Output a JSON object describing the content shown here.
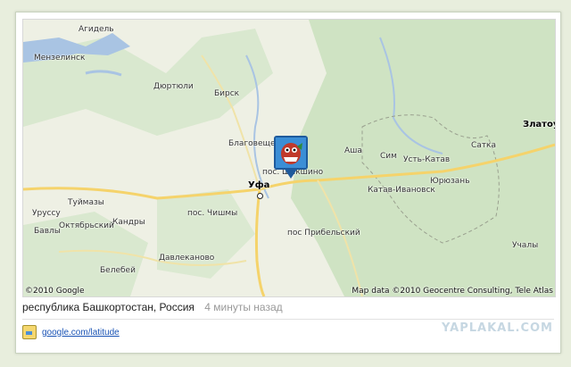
{
  "map": {
    "labels": {
      "agidel": "Агидель",
      "menzelinsk": "Мензелинск",
      "dyurtyuli": "Дюртюли",
      "birsk": "Бирск",
      "blagoveshchensk": "Благовещенск",
      "pos_chishmy": "пос. Чишмы",
      "ufa": "Уфа",
      "pos_shakshi": "пос. Шакшино",
      "pos_pribelsky": "пос Прибельский",
      "tuimazy": "Туймазы",
      "urussu": "Уруссу",
      "oktyabrsky": "Октябрьский",
      "kandry": "Кандры",
      "bavly": "Бавлы",
      "belebey": "Белебей",
      "davlekanovo": "Давлеканово",
      "asha": "Аша",
      "sim": "Сим",
      "ust_katav": "Усть-Катав",
      "satka": "Сатка",
      "zlatoust": "Златоуст",
      "katav_ivanovsk": "Катав-Ивановск",
      "yuryuzan": "Юрюзань",
      "uchaly": "Учалы"
    },
    "attribution_left": "©2010 Google",
    "attribution_right": "Map data ©2010 Geocentre Consulting, Tele Atlas",
    "marker_icon": "avatar-icon"
  },
  "location": {
    "place": "республика Башкортостан, Россия",
    "time": "4 минуты назад"
  },
  "link": {
    "text": "google.com/latitude"
  },
  "watermark": "YAPLAKAL.COM",
  "colors": {
    "map_bg": "#eef0e4",
    "forest": "#cde2c2",
    "water": "#a9c4e3",
    "road": "#f5d36b",
    "link": "#1a53b5",
    "marker": "#3b8ed6"
  }
}
